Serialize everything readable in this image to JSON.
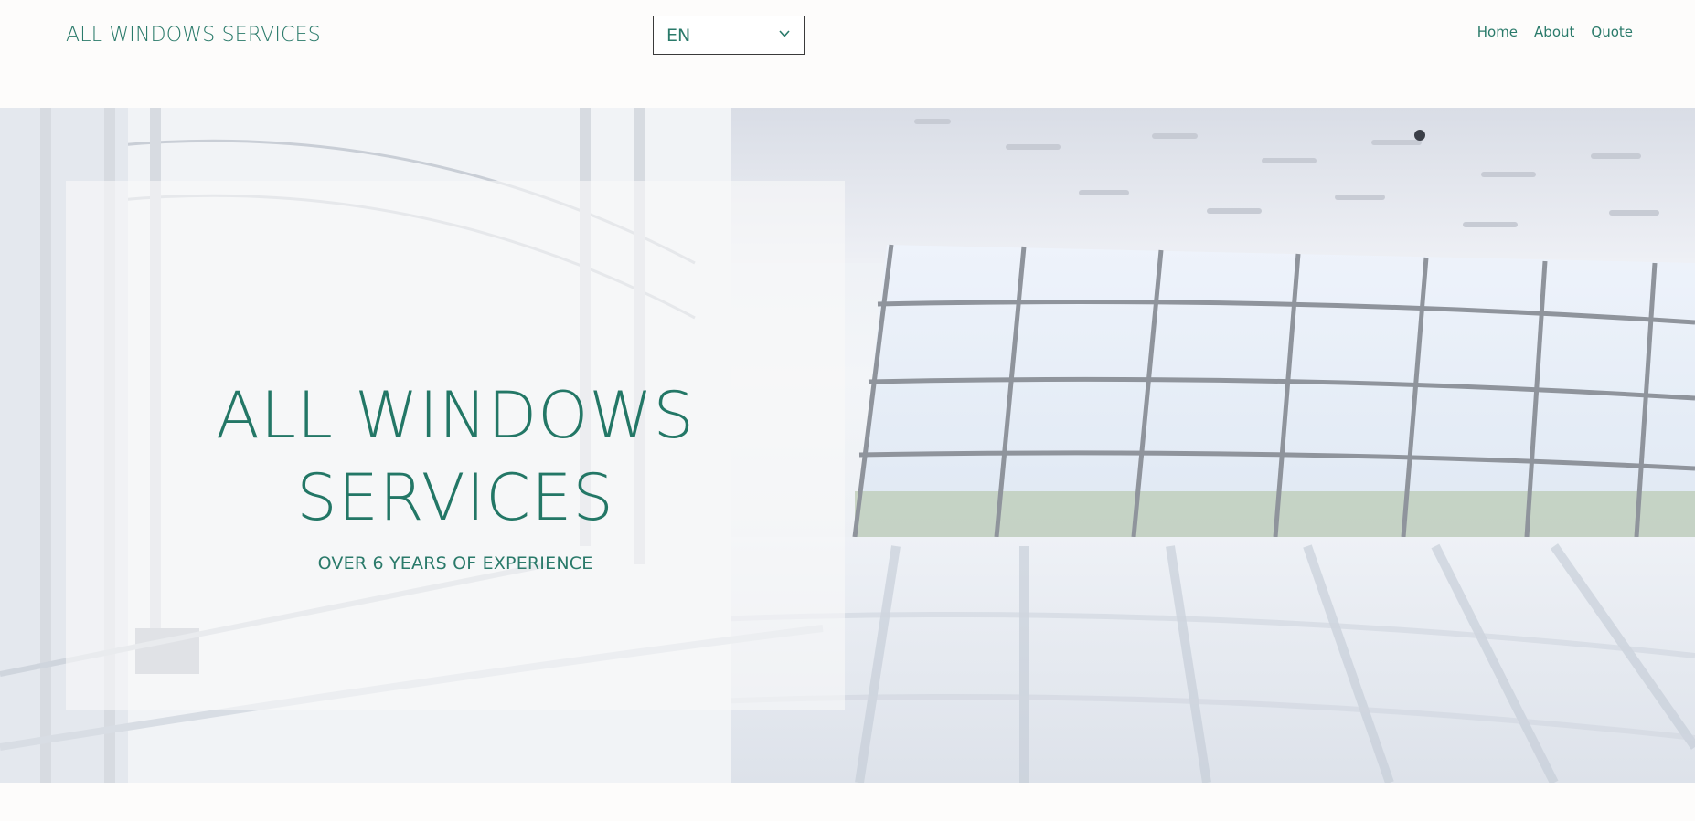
{
  "header": {
    "brand": "ALL WINDOWS SERVICES",
    "language": {
      "selected": "EN",
      "icon": "chevron-down-icon"
    },
    "nav": [
      {
        "label": "Home"
      },
      {
        "label": "About"
      },
      {
        "label": "Quote"
      }
    ]
  },
  "hero": {
    "title_line1": "ALL WINDOWS",
    "title_line2": "SERVICES",
    "subtitle": "OVER 6 YEARS OF EXPERIENCE"
  },
  "colors": {
    "accent": "#237766",
    "background": "#fdfcfb"
  }
}
